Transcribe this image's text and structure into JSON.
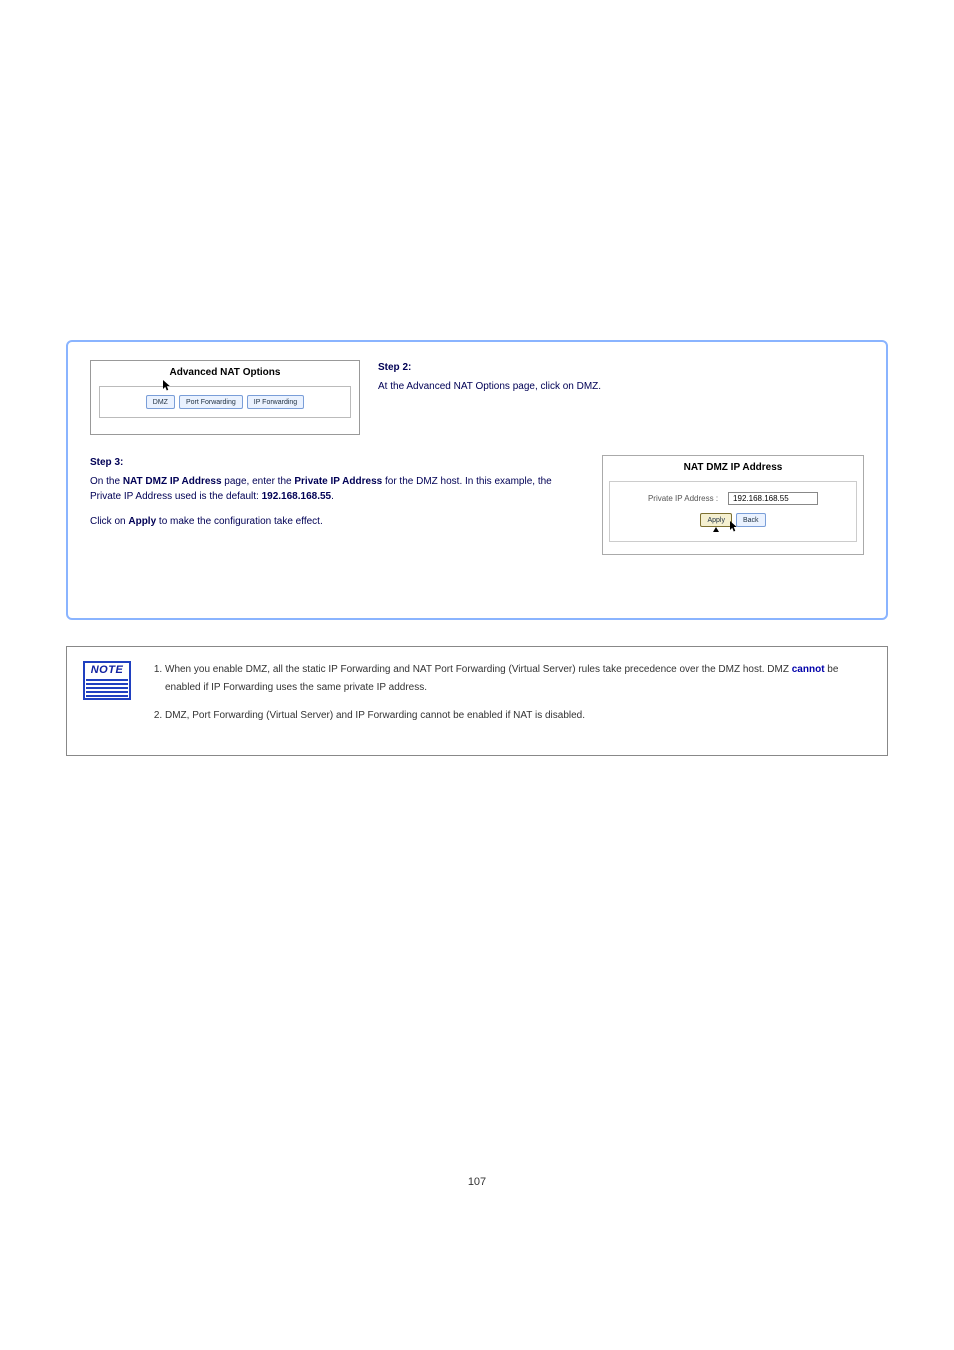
{
  "main": {
    "step2_prefix": "Step 2:",
    "step2_text": "At the Advanced NAT Options page, click on DMZ.",
    "nat_opts_title": "Advanced NAT Options",
    "btn_dmz": "DMZ",
    "btn_portfwd": "Port Forwarding",
    "btn_ipfwd": "IP Forwarding",
    "step3_prefix": "Step 3:",
    "step3_part1": "On the ",
    "step3_strong1": "NAT DMZ IP Address",
    "step3_part2": " page, enter the ",
    "step3_strong2": "Private IP Address",
    "step3_part3": " for the DMZ host. In this example, the Private IP Address used is the default: ",
    "step3_strong3": "192.168.168.55",
    "step3_part4": ".",
    "step3_part5": "Click on ",
    "step3_strong4": "Apply",
    "step3_part6": " to make the configuration take effect.",
    "dmz_title": "NAT DMZ IP Address",
    "dmz_label": "Private IP Address :",
    "dmz_value": "192.168.168.55",
    "btn_apply": "Apply",
    "btn_back": "Back"
  },
  "note": {
    "badge": "NOTE",
    "item1_part1": "When you enable DMZ, all the static IP Forwarding and NAT Port Forwarding (Virtual Server) rules take precedence over the DMZ host. DMZ ",
    "item1_strong": "cannot",
    "item1_part2": " be enabled if IP Forwarding uses the same private IP address.",
    "item2": "DMZ, Port Forwarding (Virtual Server) and IP Forwarding cannot be enabled if NAT is disabled."
  },
  "page_number": "107"
}
